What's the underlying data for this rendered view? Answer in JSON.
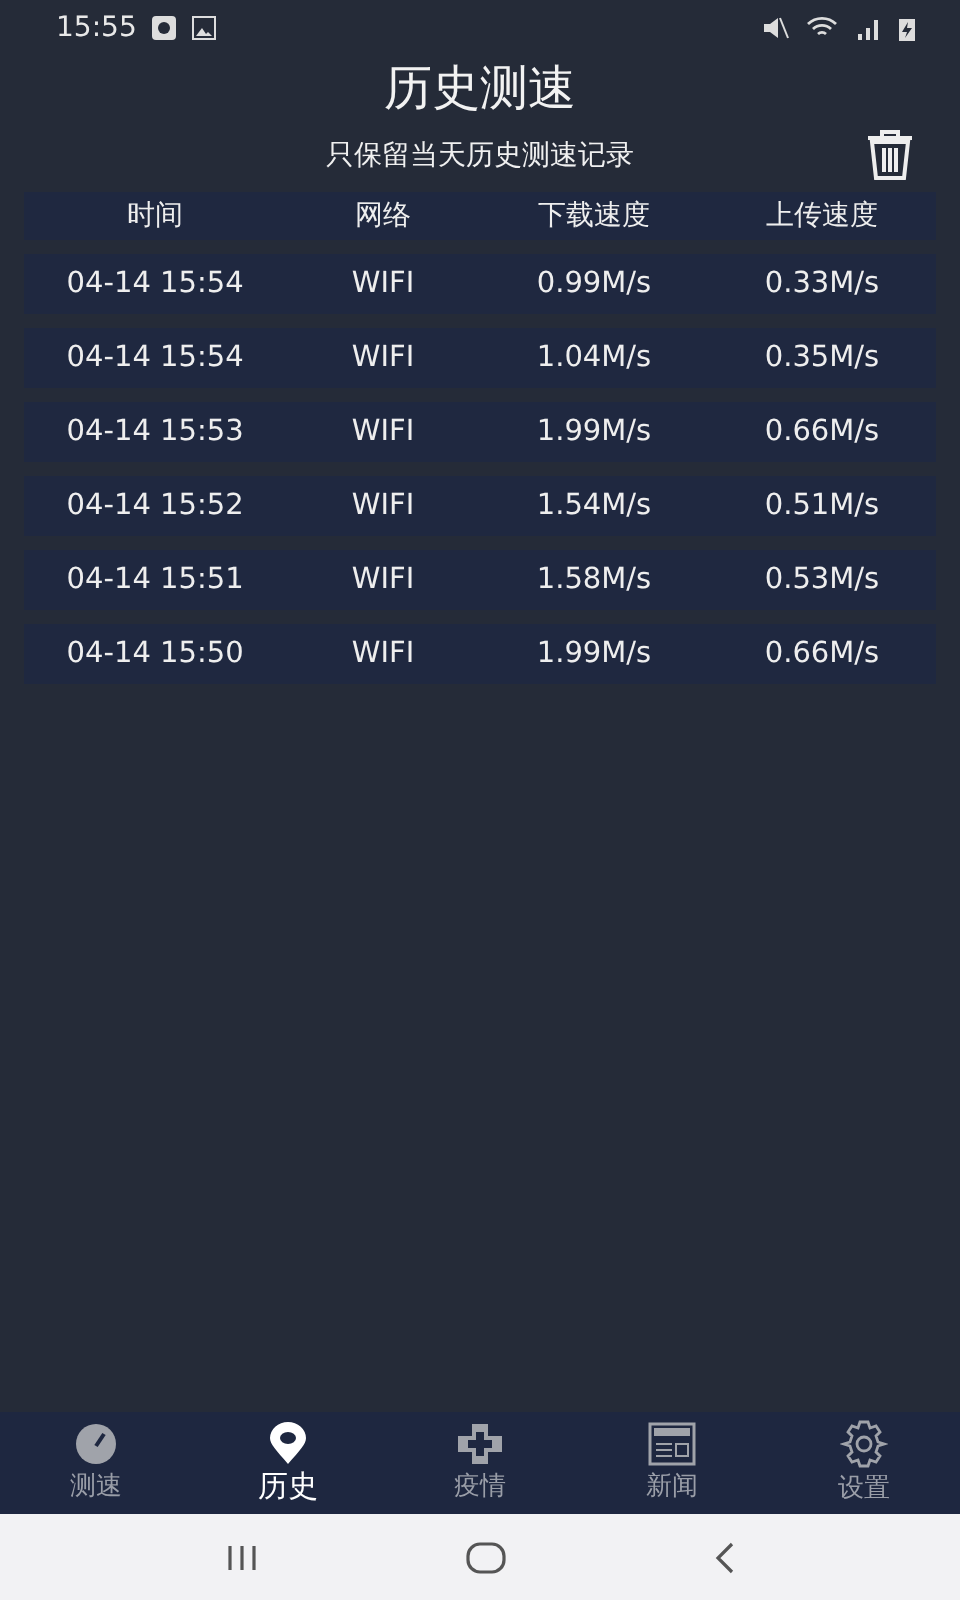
{
  "status_bar": {
    "time": "15:55"
  },
  "title": "历史测速",
  "subtitle": "只保留当天历史测速记录",
  "table": {
    "columns": [
      "时间",
      "网络",
      "下载速度",
      "上传速度"
    ],
    "rows": [
      [
        "04-14 15:54",
        "WIFI",
        "0.99M/s",
        "0.33M/s"
      ],
      [
        "04-14 15:54",
        "WIFI",
        "1.04M/s",
        "0.35M/s"
      ],
      [
        "04-14 15:53",
        "WIFI",
        "1.99M/s",
        "0.66M/s"
      ],
      [
        "04-14 15:52",
        "WIFI",
        "1.54M/s",
        "0.51M/s"
      ],
      [
        "04-14 15:51",
        "WIFI",
        "1.58M/s",
        "0.53M/s"
      ],
      [
        "04-14 15:50",
        "WIFI",
        "1.99M/s",
        "0.66M/s"
      ]
    ]
  },
  "bottom_nav": [
    {
      "label": "测速",
      "kind": "gauge",
      "selected": false
    },
    {
      "label": "历史",
      "kind": "pin",
      "selected": true
    },
    {
      "label": "疫情",
      "kind": "cross",
      "selected": false
    },
    {
      "label": "新闻",
      "kind": "news",
      "selected": false
    },
    {
      "label": "设置",
      "kind": "gear",
      "selected": false
    }
  ]
}
